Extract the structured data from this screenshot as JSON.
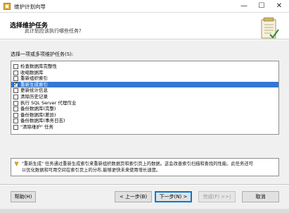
{
  "window": {
    "title": "维护计划向导",
    "min_glyph": "—",
    "max_glyph": "☐",
    "close_glyph": "✕"
  },
  "header": {
    "title": "选择维护任务",
    "subtitle": "此计划应该执行哪些任务?"
  },
  "tasks_label": "选择一项或多项维护任务(S):",
  "tasks": [
    {
      "label": "检查数据库完整性",
      "checked": false,
      "selected": false
    },
    {
      "label": "收缩数据库",
      "checked": false,
      "selected": false
    },
    {
      "label": "重新组织索引",
      "checked": false,
      "selected": false
    },
    {
      "label": "重新生成索引",
      "checked": true,
      "selected": true
    },
    {
      "label": "更新统计信息",
      "checked": false,
      "selected": false
    },
    {
      "label": "清除历史记录",
      "checked": false,
      "selected": false
    },
    {
      "label": "执行 SQL Server 代理作业",
      "checked": false,
      "selected": false
    },
    {
      "label": "备份数据库(完整)",
      "checked": false,
      "selected": false
    },
    {
      "label": "备份数据库(差异)",
      "checked": false,
      "selected": false
    },
    {
      "label": "备份数据库(事务日志)",
      "checked": false,
      "selected": false
    },
    {
      "label": "\"清除维护\" 任务",
      "checked": false,
      "selected": false
    }
  ],
  "check_glyph": "✓",
  "description": {
    "line1": "\"重新生成\" 任务通过重新生成索引来重新组织数据页和索引页上的数据。这会改善索引扫描和查找的性能。此任务还可",
    "line2": "以优化数据和可用空间在索引页上的分布,能够更快未来使用增长速度。"
  },
  "buttons": {
    "help": "帮助(H)",
    "back": "< 上一步(B)",
    "next": "下一步(N) >",
    "finish": "完成(F) >>|",
    "cancel": "取消"
  },
  "colors": {
    "selection": "#3278d6",
    "default_button_border": "#0078d7"
  }
}
